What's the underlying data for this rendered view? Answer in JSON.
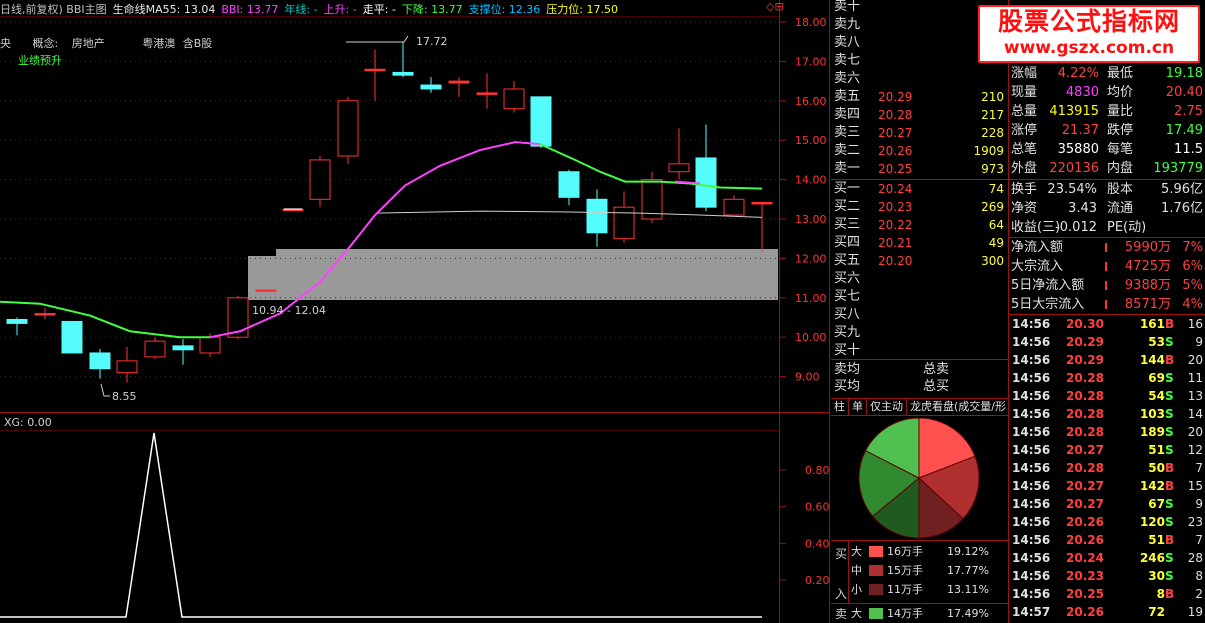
{
  "header": {
    "items": [
      {
        "text": "日线,前复权) BBI主图",
        "color": "#c0c0c0"
      },
      {
        "text": "生命线MA55: 13.04",
        "color": "#e8e8e8"
      },
      {
        "text": "BBI: 13.77",
        "color": "#ff40ff"
      },
      {
        "text": "年线: -",
        "color": "#00c0c0"
      },
      {
        "text": "上升: -",
        "color": "#ff40ff"
      },
      {
        "text": "走平: -",
        "color": "#ffffff"
      },
      {
        "text": "下降: 13.77",
        "color": "#40ff40"
      },
      {
        "text": "支撑位: 12.36",
        "color": "#00c0ff"
      },
      {
        "text": "压力位: 17.50",
        "color": "#ffff00"
      }
    ],
    "line2": [
      "央",
      "概念:",
      "房地产",
      "粤港澳",
      "含B股"
    ],
    "line3": "业绩预升"
  },
  "main_chart": {
    "price_ticks": [
      "18.00",
      "17.00",
      "16.00",
      "15.00",
      "14.00",
      "13.00",
      "12.00",
      "11.00",
      "10.00",
      "9.00"
    ],
    "annotations": {
      "high": "17.72",
      "low": "8.55",
      "range": "10.94 - 12.04"
    },
    "colors": {
      "up": "#ff3232",
      "down": "#54fcfc",
      "bbi_up": "#ff40ff",
      "bbi_down": "#40ff40",
      "ma": "#d0d0d0",
      "box": "#999999"
    }
  },
  "sub_chart": {
    "label": "XG: 0.00",
    "ticks": [
      "0.80",
      "0.60",
      "0.40",
      "0.20"
    ]
  },
  "watermark": {
    "title": "股票公式指标网",
    "url": "www.gszx.com.cn"
  },
  "order_book": {
    "sells": [
      {
        "label": "卖十",
        "price": "",
        "vol": ""
      },
      {
        "label": "卖九",
        "price": "",
        "vol": ""
      },
      {
        "label": "卖八",
        "price": "",
        "vol": ""
      },
      {
        "label": "卖七",
        "price": "",
        "vol": ""
      },
      {
        "label": "卖六",
        "price": "",
        "vol": ""
      },
      {
        "label": "卖五",
        "price": "20.29",
        "vol": "210"
      },
      {
        "label": "卖四",
        "price": "20.28",
        "vol": "217"
      },
      {
        "label": "卖三",
        "price": "20.27",
        "vol": "228"
      },
      {
        "label": "卖二",
        "price": "20.26",
        "vol": "1909"
      },
      {
        "label": "卖一",
        "price": "20.25",
        "vol": "973"
      }
    ],
    "buys": [
      {
        "label": "买一",
        "price": "20.24",
        "vol": "74"
      },
      {
        "label": "买二",
        "price": "20.23",
        "vol": "269"
      },
      {
        "label": "买三",
        "price": "20.22",
        "vol": "64"
      },
      {
        "label": "买四",
        "price": "20.21",
        "vol": "49"
      },
      {
        "label": "买五",
        "price": "20.20",
        "vol": "300"
      },
      {
        "label": "买六",
        "price": "",
        "vol": ""
      },
      {
        "label": "买七",
        "price": "",
        "vol": ""
      },
      {
        "label": "买八",
        "price": "",
        "vol": ""
      },
      {
        "label": "买九",
        "price": "",
        "vol": ""
      },
      {
        "label": "买十",
        "price": "",
        "vol": ""
      }
    ],
    "avg": [
      {
        "label": "卖均",
        "total": "总卖"
      },
      {
        "label": "买均",
        "total": "总买"
      }
    ]
  },
  "tabs": [
    "柱",
    "单",
    "仅主动",
    "龙虎看盘(成交量/形"
  ],
  "pie": {
    "slices": [
      {
        "name": "买大",
        "pct": 19.12,
        "color": "#ff5050"
      },
      {
        "name": "买中",
        "pct": 17.77,
        "color": "#b03030"
      },
      {
        "name": "买小",
        "pct": 13.11,
        "color": "#702020"
      },
      {
        "name": "卖小",
        "pct": 14.01,
        "color": "#205a20"
      },
      {
        "name": "卖中",
        "pct": 18.5,
        "color": "#308a30"
      },
      {
        "name": "卖大",
        "pct": 17.49,
        "color": "#50c050"
      }
    ]
  },
  "legend": {
    "buy_label": [
      "买",
      "入"
    ],
    "sell_label": [
      "卖"
    ],
    "rows": [
      {
        "size": "大",
        "amount": "16万手",
        "pct": "19.12%",
        "color": "#ff5050"
      },
      {
        "size": "中",
        "amount": "15万手",
        "pct": "17.77%",
        "color": "#b03030"
      },
      {
        "size": "小",
        "amount": "11万手",
        "pct": "13.11%",
        "color": "#702020"
      },
      {
        "size": "大",
        "amount": "14万手",
        "pct": "17.49%",
        "color": "#50c050"
      }
    ]
  },
  "stats": [
    {
      "l1": "涨幅",
      "v1": "4.22%",
      "c1": "#ff4040",
      "l2": "最低",
      "v2": "19.18",
      "c2": "#40ff40"
    },
    {
      "l1": "现量",
      "v1": "4830",
      "c1": "#ff40ff",
      "l2": "均价",
      "v2": "20.40",
      "c2": "#ff4040"
    },
    {
      "l1": "总量",
      "v1": "413915",
      "c1": "#ffff00",
      "l2": "量比",
      "v2": "2.75",
      "c2": "#ff4040"
    },
    {
      "l1": "涨停",
      "v1": "21.37",
      "c1": "#ff4040",
      "l2": "跌停",
      "v2": "17.49",
      "c2": "#40ff40"
    },
    {
      "l1": "总笔",
      "v1": "35880",
      "c1": "#ffffff",
      "l2": "每笔",
      "v2": "11.5",
      "c2": "#ffffff"
    },
    {
      "l1": "外盘",
      "v1": "220136",
      "c1": "#ff4040",
      "l2": "内盘",
      "v2": "193779",
      "c2": "#40ff40"
    }
  ],
  "stats2": [
    {
      "l1": "换手",
      "v1": "23.54%",
      "l2": "股本",
      "v2": "5.96亿"
    },
    {
      "l1": "净资",
      "v1": "3.43",
      "l2": "流通",
      "v2": "1.76亿"
    },
    {
      "l1": "收益(三)",
      "v1": "-0.012",
      "l2": "PE(动)",
      "v2": ""
    }
  ],
  "flows": [
    {
      "label": "净流入额",
      "value": "5990万",
      "pct": "7%"
    },
    {
      "label": "大宗流入",
      "value": "4725万",
      "pct": "6%"
    },
    {
      "label": "5日净流入额",
      "value": "9388万",
      "pct": "5%"
    },
    {
      "label": "5日大宗流入",
      "value": "8571万",
      "pct": "4%"
    }
  ],
  "trades": [
    {
      "time": "14:56",
      "price": "20.30",
      "vol": "161",
      "bs": "B",
      "n": "16"
    },
    {
      "time": "14:56",
      "price": "20.29",
      "vol": "53",
      "bs": "S",
      "n": "9"
    },
    {
      "time": "14:56",
      "price": "20.29",
      "vol": "144",
      "bs": "B",
      "n": "20"
    },
    {
      "time": "14:56",
      "price": "20.28",
      "vol": "69",
      "bs": "S",
      "n": "11"
    },
    {
      "time": "14:56",
      "price": "20.28",
      "vol": "54",
      "bs": "S",
      "n": "13"
    },
    {
      "time": "14:56",
      "price": "20.28",
      "vol": "103",
      "bs": "S",
      "n": "14"
    },
    {
      "time": "14:56",
      "price": "20.28",
      "vol": "189",
      "bs": "S",
      "n": "20"
    },
    {
      "time": "14:56",
      "price": "20.27",
      "vol": "51",
      "bs": "S",
      "n": "12"
    },
    {
      "time": "14:56",
      "price": "20.28",
      "vol": "50",
      "bs": "B",
      "n": "7"
    },
    {
      "time": "14:56",
      "price": "20.27",
      "vol": "142",
      "bs": "B",
      "n": "15"
    },
    {
      "time": "14:56",
      "price": "20.27",
      "vol": "67",
      "bs": "S",
      "n": "9"
    },
    {
      "time": "14:56",
      "price": "20.26",
      "vol": "120",
      "bs": "S",
      "n": "23"
    },
    {
      "time": "14:56",
      "price": "20.26",
      "vol": "51",
      "bs": "B",
      "n": "7"
    },
    {
      "time": "14:56",
      "price": "20.24",
      "vol": "246",
      "bs": "S",
      "n": "28"
    },
    {
      "time": "14:56",
      "price": "20.23",
      "vol": "30",
      "bs": "S",
      "n": "8"
    },
    {
      "time": "14:56",
      "price": "20.25",
      "vol": "8",
      "bs": "B",
      "n": "2"
    },
    {
      "time": "14:57",
      "price": "20.26",
      "vol": "72",
      "bs": "",
      "n": "19"
    }
  ]
}
